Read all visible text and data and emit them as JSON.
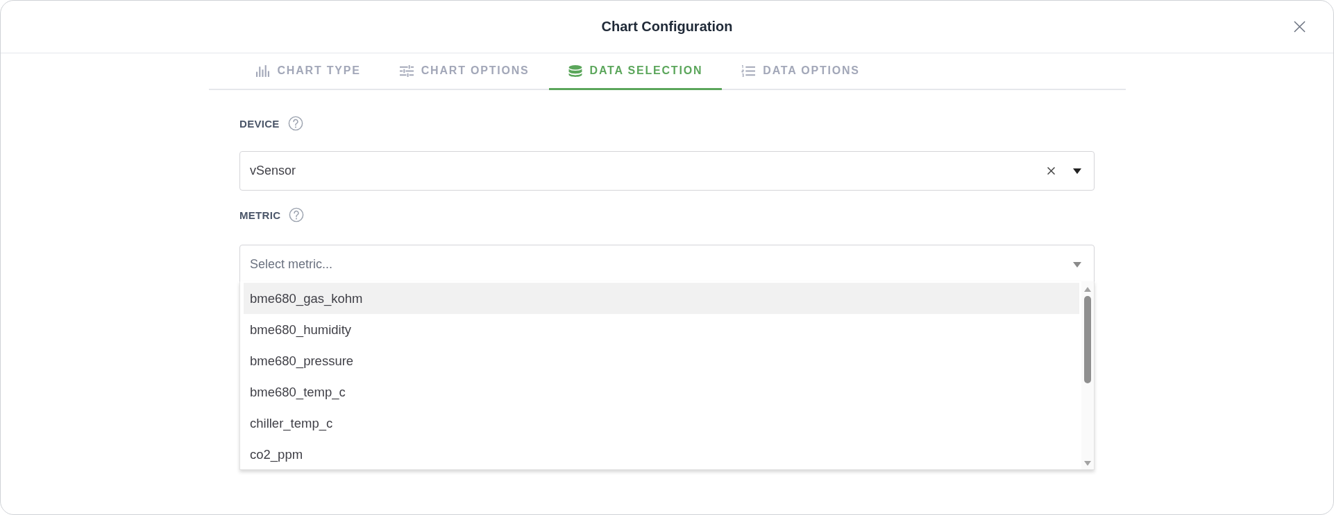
{
  "dialog": {
    "title": "Chart Configuration"
  },
  "tabs": [
    {
      "label": "CHART TYPE",
      "selected": false
    },
    {
      "label": "CHART OPTIONS",
      "selected": false
    },
    {
      "label": "DATA SELECTION",
      "selected": true
    },
    {
      "label": "DATA OPTIONS",
      "selected": false
    }
  ],
  "device": {
    "label": "DEVICE",
    "value": "vSensor"
  },
  "metric": {
    "label": "METRIC",
    "placeholder": "Select metric...",
    "expanded": true,
    "options": [
      {
        "label": "bme680_gas_kohm",
        "highlighted": true
      },
      {
        "label": "bme680_humidity",
        "highlighted": false
      },
      {
        "label": "bme680_pressure",
        "highlighted": false
      },
      {
        "label": "bme680_temp_c",
        "highlighted": false
      },
      {
        "label": "chiller_temp_c",
        "highlighted": false
      },
      {
        "label": "co2_ppm",
        "highlighted": false
      }
    ]
  }
}
